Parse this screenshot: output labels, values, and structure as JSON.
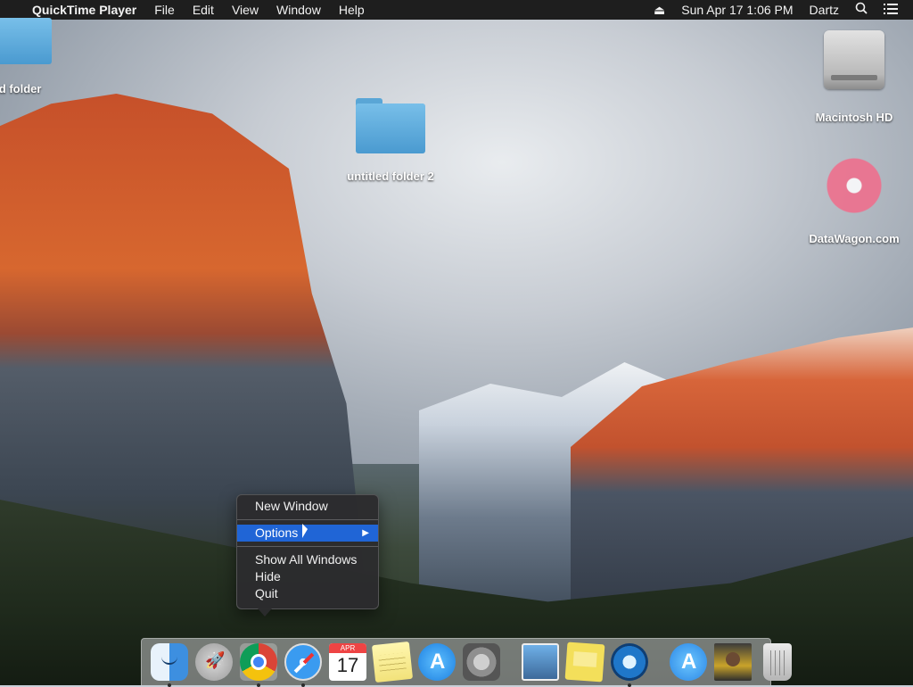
{
  "menubar": {
    "apple_icon": "",
    "app_name": "QuickTime Player",
    "menus": [
      "File",
      "Edit",
      "View",
      "Window",
      "Help"
    ],
    "clock": "Sun Apr 17  1:06 PM",
    "user": "Dartz",
    "icons": [
      "eject-icon",
      "search-icon",
      "list-icon"
    ]
  },
  "desktop": {
    "icons": [
      {
        "label": "itled folder",
        "kind": "folder"
      },
      {
        "label": "untitled folder 2",
        "kind": "folder"
      },
      {
        "label": "Macintosh HD",
        "kind": "hard-drive"
      },
      {
        "label": "DataWagon.com",
        "kind": "image-file"
      }
    ]
  },
  "context_menu": {
    "items": [
      {
        "label": "New Window"
      },
      {
        "label": "Options",
        "selected": true,
        "submenu": true
      },
      {
        "label": "Show All Windows"
      },
      {
        "label": "Hide"
      },
      {
        "label": "Quit"
      }
    ],
    "submenu_arrow": "▶"
  },
  "dock": {
    "calendar_month": "APR",
    "calendar_day": "17",
    "apps": [
      "Finder",
      "Launchpad",
      "Google Chrome",
      "Safari",
      "Calendar",
      "Notes",
      "App Store",
      "System Preferences",
      "Preview",
      "Stickies",
      "QuickTime Player",
      "App Store",
      "Photo",
      "Trash"
    ]
  },
  "colors": {
    "menubar_bg": "#1e1e1e",
    "menu_selection": "#2065d6",
    "menu_bg": "#2c2c2e"
  }
}
